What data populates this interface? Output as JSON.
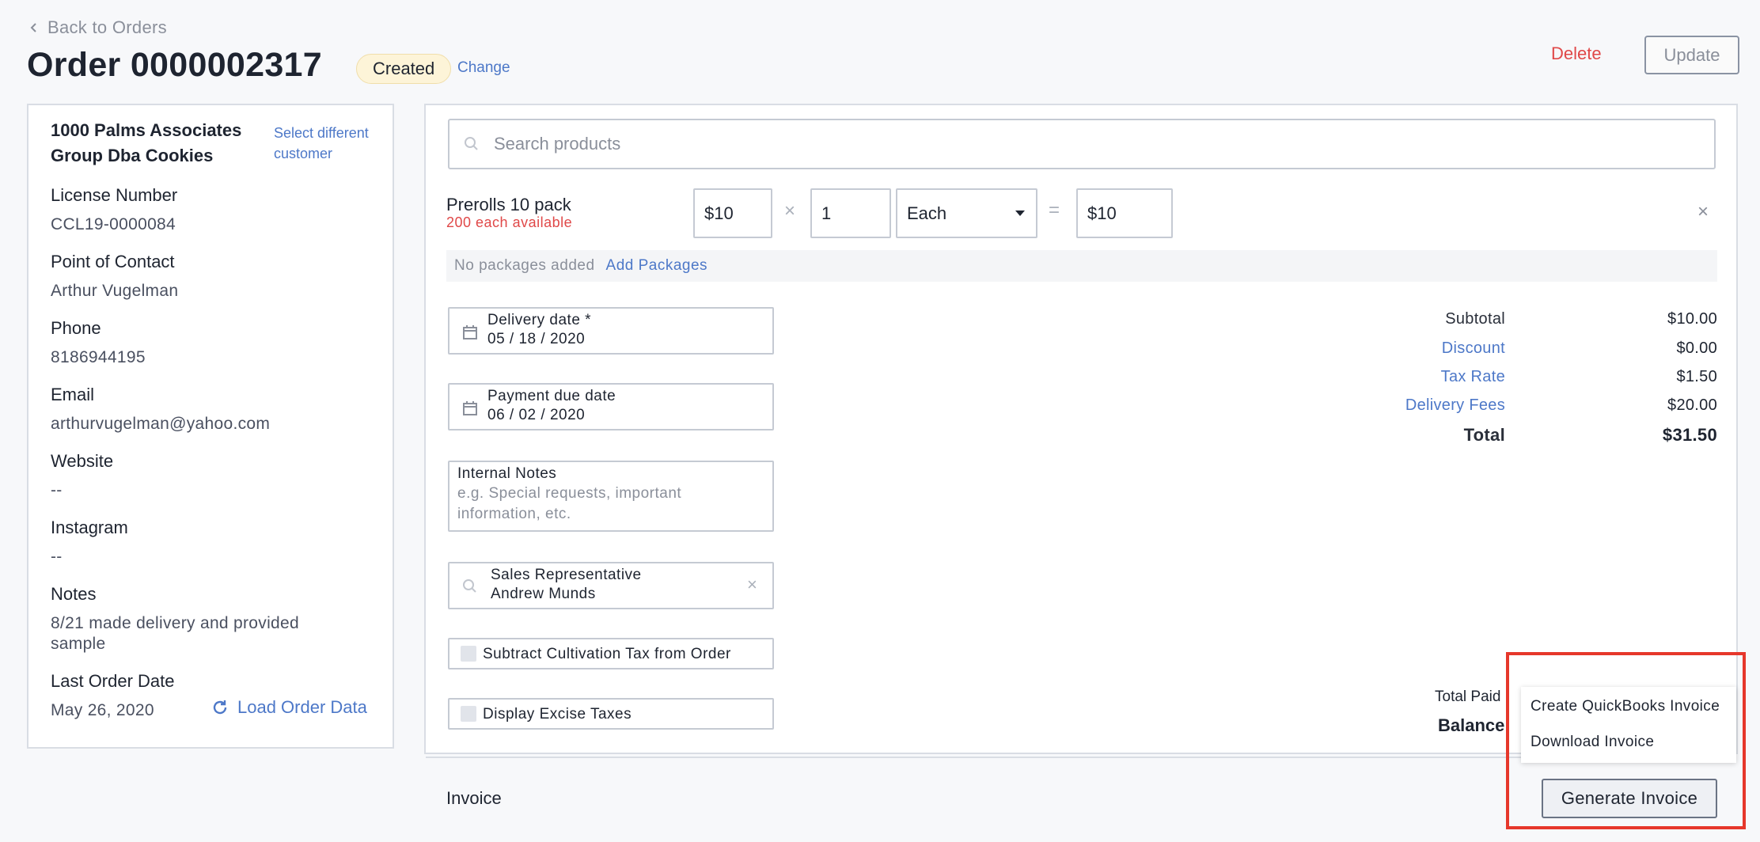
{
  "header": {
    "back_label": "Back to Orders",
    "title": "Order 0000002317",
    "status_badge": "Created",
    "change_link": "Change",
    "delete_label": "Delete",
    "update_label": "Update"
  },
  "customer": {
    "name": "1000 Palms Associates Group Dba Cookies",
    "select_different": "Select different customer",
    "fields": [
      {
        "label": "License Number",
        "value": "CCL19-0000084"
      },
      {
        "label": "Point of Contact",
        "value": "Arthur Vugelman"
      },
      {
        "label": "Phone",
        "value": "8186944195"
      },
      {
        "label": "Email",
        "value": "arthurvugelman@yahoo.com"
      },
      {
        "label": "Website",
        "value": "--"
      },
      {
        "label": "Instagram",
        "value": "--"
      },
      {
        "label": "Notes",
        "value": "8/21 made delivery and provided sample"
      },
      {
        "label": "Last Order Date",
        "value": "May 26, 2020"
      }
    ],
    "load_order_data": "Load Order Data"
  },
  "search": {
    "placeholder": "Search products"
  },
  "line_item": {
    "name": "Prerolls 10 pack",
    "availability": "200 each available",
    "price": "$10",
    "times": "×",
    "quantity": "1",
    "unit": "Each",
    "equals": "=",
    "total": "$10",
    "remove": "×",
    "no_packages": "No packages added",
    "add_packages": "Add Packages"
  },
  "form": {
    "delivery_label": "Delivery date *",
    "delivery_value": "05 / 18 / 2020",
    "payment_label": "Payment due date",
    "payment_value": "06 / 02 / 2020",
    "notes_label": "Internal Notes",
    "notes_placeholder": "e.g. Special requests, important information, etc.",
    "sales_rep_label": "Sales Representative",
    "sales_rep_value": "Andrew Munds",
    "clear": "×",
    "subtract_tax": "Subtract Cultivation Tax from Order",
    "display_excise": "Display Excise Taxes"
  },
  "summary": {
    "subtotal_label": "Subtotal",
    "subtotal": "$10.00",
    "discount_label": "Discount",
    "discount": "$0.00",
    "tax_label": "Tax Rate",
    "tax": "$1.50",
    "delivery_label": "Delivery Fees",
    "delivery": "$20.00",
    "total_label": "Total",
    "total": "$31.50",
    "total_paid_label": "Total Paid",
    "balance_label": "Balance"
  },
  "invoice": {
    "section_label": "Invoice",
    "menu_items": [
      "Create QuickBooks Invoice",
      "Download Invoice"
    ],
    "generate_label": "Generate Invoice"
  },
  "colors": {
    "accent_link": "#4d78c8",
    "danger": "#e04848",
    "highlight": "#e6372b",
    "badge_bg": "#fdf4d8"
  }
}
